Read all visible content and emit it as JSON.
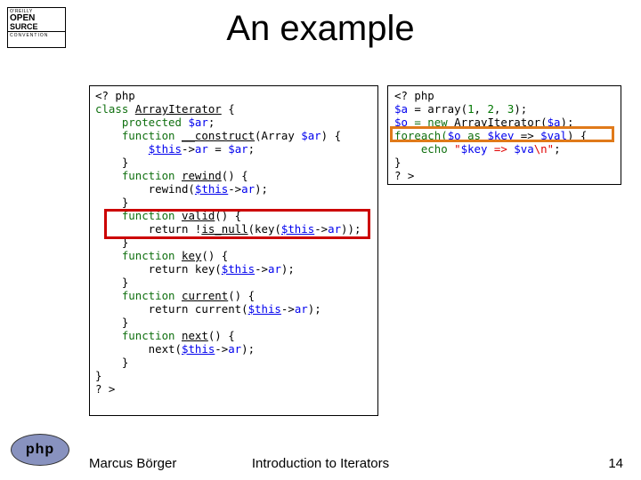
{
  "logo": {
    "line1": "O'REILLY",
    "line2a": "OPEN",
    "line2b": "S",
    "line2c": "URCE",
    "line3": "CONVENTION"
  },
  "title": "An example",
  "codeLeft": {
    "l01a": "<? ",
    "l01b": "php",
    "l02a": "class ",
    "l02b": "ArrayIterator",
    "l02c": " {",
    "l03a": "    protected ",
    "l03b": "$ar",
    "l03c": ";",
    "l04a": "    function ",
    "l04b": "__construct",
    "l04c": "(Array ",
    "l04d": "$ar",
    "l04e": ") {",
    "l05a": "        ",
    "l05b": "$this",
    "l05c": "->",
    "l05d": "ar",
    "l05e": " = ",
    "l05f": "$ar",
    "l05g": ";",
    "l06": "    }",
    "l07a": "    function ",
    "l07b": "rewind",
    "l07c": "() {",
    "l08a": "        rewind(",
    "l08b": "$this",
    "l08c": "->",
    "l08d": "ar",
    "l08e": ");",
    "l09": "    }",
    "l10a": "    function ",
    "l10b": "valid",
    "l10c": "() {",
    "l11a": "        return !",
    "l11b": "is_null",
    "l11c": "(key(",
    "l11d": "$this",
    "l11e": "->",
    "l11f": "ar",
    "l11g": "));",
    "l12": "    }",
    "l13a": "    function ",
    "l13b": "key",
    "l13c": "() {",
    "l14a": "        return key(",
    "l14b": "$this",
    "l14c": "->",
    "l14d": "ar",
    "l14e": ");",
    "l15": "    }",
    "l16a": "    function ",
    "l16b": "current",
    "l16c": "() {",
    "l17a": "        return current(",
    "l17b": "$this",
    "l17c": "->",
    "l17d": "ar",
    "l17e": ");",
    "l18": "    }",
    "l19a": "    function ",
    "l19b": "next",
    "l19c": "() {",
    "l20a": "        next(",
    "l20b": "$this",
    "l20c": "->",
    "l20d": "ar",
    "l20e": ");",
    "l21": "    }",
    "l22": "}",
    "l23": "? >"
  },
  "codeRight": {
    "r01a": "<? ",
    "r01b": "php",
    "r02a": "$a",
    "r02b": " = array(",
    "r02c": "1",
    "r02d": ", ",
    "r02e": "2",
    "r02f": ", ",
    "r02g": "3",
    "r02h": ");",
    "r03a": "$o",
    "r03b": " = new ",
    "r03c": "ArrayIterator",
    "r03d": "(",
    "r03e": "$a",
    "r03f": ");",
    "r04a": "foreach(",
    "r04b": "$o",
    "r04c": " as ",
    "r04d": "$key",
    "r04e": " => ",
    "r04f": "$val",
    "r04g": ") {",
    "r05a": "    echo ",
    "r05b": "\"",
    "r05c": "$key",
    "r05d": " => ",
    "r05e": "$va",
    "r05f": "\\n\"",
    "r05g": ";",
    "r06": "}",
    "r07": "? >"
  },
  "phpLogo": "php",
  "footer": {
    "author": "Marcus Börger",
    "center": "Introduction to Iterators",
    "page": "14"
  }
}
